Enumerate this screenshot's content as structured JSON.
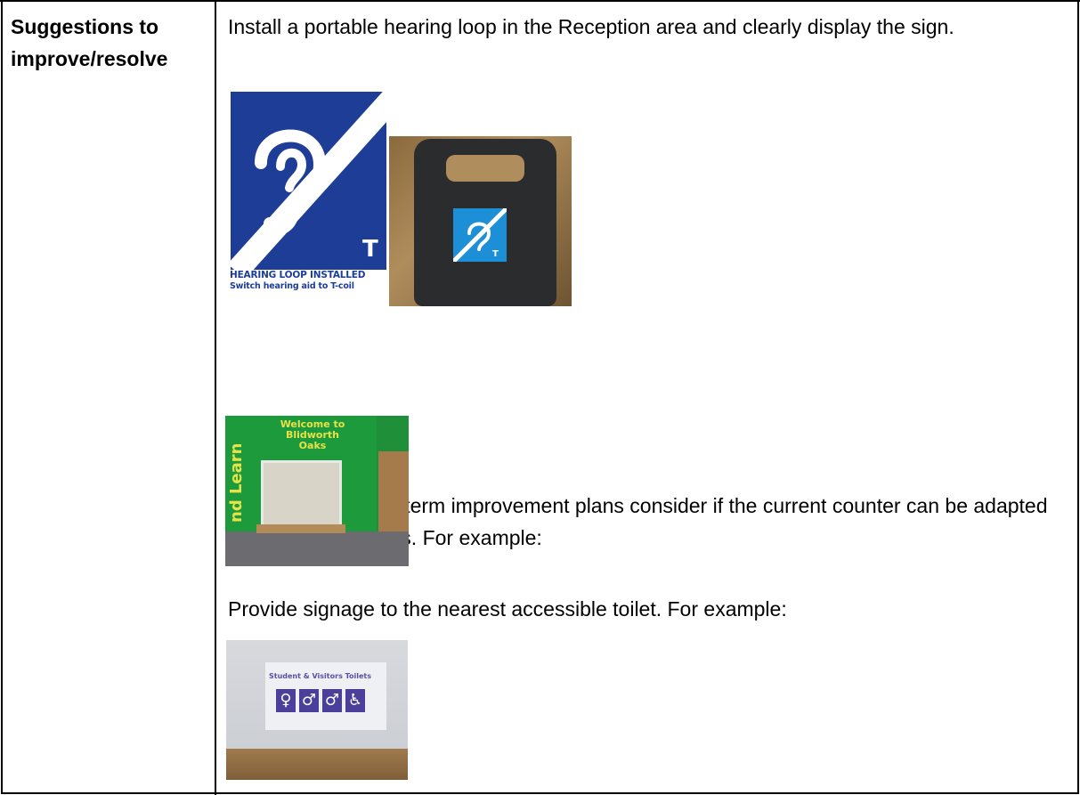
{
  "row_label": "Suggestions to improve/resolve",
  "paragraphs": {
    "p1": "Install a portable hearing loop in the Reception area and clearly display the sign.",
    "p2": "In the schools long term improvement plans consider if the current counter can be adapted for wheelchair users. For example:",
    "p3": "Provide signage to the nearest accessible toilet. For example:"
  },
  "images": {
    "loop_sign": {
      "letter": "T",
      "caption_line1": "HEARING LOOP INSTALLED",
      "caption_line2": "Switch hearing aid to T-coil"
    },
    "reception": {
      "sign_text": "Welcome to Blidworth Oaks",
      "side_text": "nd Learn"
    },
    "toilet": {
      "sign_text": "Student & Visitors Toilets"
    }
  },
  "colors": {
    "loop_blue": "#1e3d97",
    "badge_blue": "#1d8fd6",
    "reception_green": "#1d9a3b",
    "toilet_purple": "#4a3f9a"
  }
}
